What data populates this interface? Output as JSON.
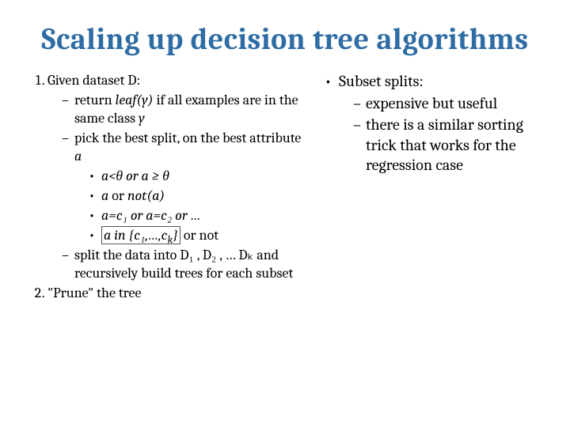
{
  "title": "Scaling up decision tree algorithms",
  "left": {
    "n1": "Given dataset D:",
    "d1a": "return ",
    "d1b": "leaf(y)",
    "d1c": " if all examples are in the same class ",
    "d1d": "y",
    "d2a": "pick the best split, on the best attribute ",
    "d2b": "a",
    "b1": "a<θ   or  a ≥ θ",
    "b2a": "a",
    "b2b": "  or  ",
    "b2c": "not(a)",
    "b3": "a=c₁  or  a=c₂  or …",
    "b4a": "a in {c₁,…,c",
    "b4k": "k",
    "b4b": "}",
    "b4c": "  or not",
    "d3": "split the data into D₁ , D₂ , … Dₖ and recursively build trees for each subset",
    "n2": "\"Prune\" the tree"
  },
  "right": {
    "h": "Subset splits:",
    "r1": "expensive but useful",
    "r2": "there is a similar sorting trick that works for the regression case"
  }
}
